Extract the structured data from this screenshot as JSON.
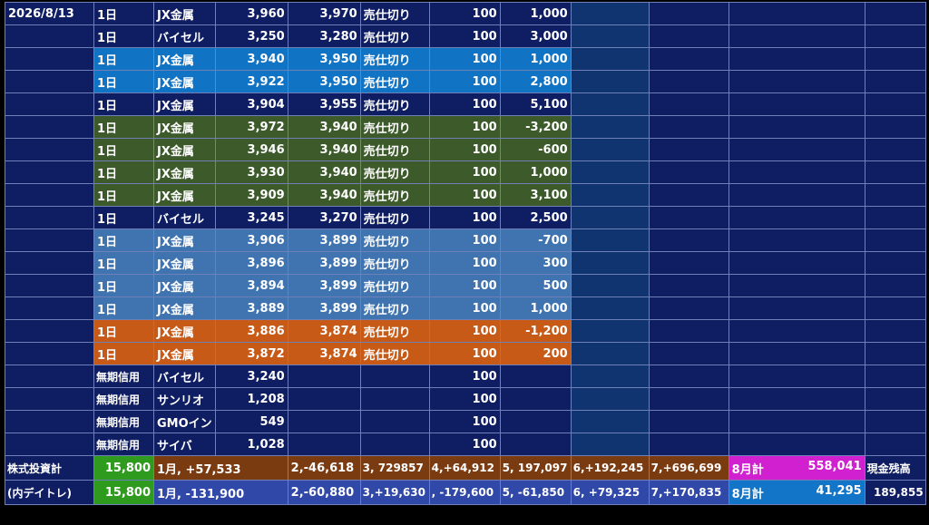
{
  "trades": [
    {
      "date": "2026/8/13",
      "period": "1日",
      "name": "JX金属",
      "buy": "3,960",
      "sell": "3,970",
      "type": "売仕切り",
      "qty": "100",
      "pnl": "1,000",
      "color": "dark"
    },
    {
      "date": "",
      "period": "1日",
      "name": "バイセル",
      "buy": "3,250",
      "sell": "3,280",
      "type": "売仕切り",
      "qty": "100",
      "pnl": "3,000",
      "color": "dark"
    },
    {
      "date": "",
      "period": "1日",
      "name": "JX金属",
      "buy": "3,940",
      "sell": "3,950",
      "type": "売仕切り",
      "qty": "100",
      "pnl": "1,000",
      "color": "blue"
    },
    {
      "date": "",
      "period": "1日",
      "name": "JX金属",
      "buy": "3,922",
      "sell": "3,950",
      "type": "売仕切り",
      "qty": "100",
      "pnl": "2,800",
      "color": "blue"
    },
    {
      "date": "",
      "period": "1日",
      "name": "JX金属",
      "buy": "3,904",
      "sell": "3,955",
      "type": "売仕切り",
      "qty": "100",
      "pnl": "5,100",
      "color": "dark"
    },
    {
      "date": "",
      "period": "1日",
      "name": "JX金属",
      "buy": "3,972",
      "sell": "3,940",
      "type": "売仕切り",
      "qty": "100",
      "pnl": "-3,200",
      "color": "green"
    },
    {
      "date": "",
      "period": "1日",
      "name": "JX金属",
      "buy": "3,946",
      "sell": "3,940",
      "type": "売仕切り",
      "qty": "100",
      "pnl": "-600",
      "color": "green"
    },
    {
      "date": "",
      "period": "1日",
      "name": "JX金属",
      "buy": "3,930",
      "sell": "3,940",
      "type": "売仕切り",
      "qty": "100",
      "pnl": "1,000",
      "color": "green"
    },
    {
      "date": "",
      "period": "1日",
      "name": "JX金属",
      "buy": "3,909",
      "sell": "3,940",
      "type": "売仕切り",
      "qty": "100",
      "pnl": "3,100",
      "color": "green"
    },
    {
      "date": "",
      "period": "1日",
      "name": "バイセル",
      "buy": "3,245",
      "sell": "3,270",
      "type": "売仕切り",
      "qty": "100",
      "pnl": "2,500",
      "color": "dark"
    },
    {
      "date": "",
      "period": "1日",
      "name": "JX金属",
      "buy": "3,906",
      "sell": "3,899",
      "type": "売仕切り",
      "qty": "100",
      "pnl": "-700",
      "color": "steel"
    },
    {
      "date": "",
      "period": "1日",
      "name": "JX金属",
      "buy": "3,896",
      "sell": "3,899",
      "type": "売仕切り",
      "qty": "100",
      "pnl": "300",
      "color": "steel"
    },
    {
      "date": "",
      "period": "1日",
      "name": "JX金属",
      "buy": "3,894",
      "sell": "3,899",
      "type": "売仕切り",
      "qty": "100",
      "pnl": "500",
      "color": "steel"
    },
    {
      "date": "",
      "period": "1日",
      "name": "JX金属",
      "buy": "3,889",
      "sell": "3,899",
      "type": "売仕切り",
      "qty": "100",
      "pnl": "1,000",
      "color": "steel"
    },
    {
      "date": "",
      "period": "1日",
      "name": "JX金属",
      "buy": "3,886",
      "sell": "3,874",
      "type": "売仕切り",
      "qty": "100",
      "pnl": "-1,200",
      "color": "orange"
    },
    {
      "date": "",
      "period": "1日",
      "name": "JX金属",
      "buy": "3,872",
      "sell": "3,874",
      "type": "売仕切り",
      "qty": "100",
      "pnl": "200",
      "color": "orange"
    }
  ],
  "holdings": [
    {
      "period": "無期信用",
      "name": "バイセル",
      "price": "3,240",
      "qty": "100"
    },
    {
      "period": "無期信用",
      "name": "サンリオ",
      "price": "1,208",
      "qty": "100"
    },
    {
      "period": "無期信用",
      "name": "GMOイン",
      "price": "549",
      "qty": "100"
    },
    {
      "period": "無期信用",
      "name": "サイバ",
      "price": "1,028",
      "qty": "100"
    }
  ],
  "summary": {
    "stock": {
      "label": "株式投資計",
      "value": "15,800",
      "m1": "1月, +57,533",
      "m2": "2,-46,618",
      "m3": "3, 729857",
      "m4": "4,+64,912",
      "m5": "5, 197,097",
      "m6": "6,+192,245",
      "m7": "7,+696,699",
      "month_label": "8月計",
      "month_value": "558,041",
      "cash_label": "現金残高"
    },
    "day": {
      "label": "(内デイトレ)",
      "value": "15,800",
      "m1": "1月, -131,900",
      "m2": "2,-60,880",
      "m3": "3,+19,630",
      "m4": ", -179,600",
      "m5": "5, -61,850",
      "m6": "6, +79,325",
      "m7": "7,+170,835",
      "month_label": "8月計",
      "month_value": "41,295",
      "cash_value": "189,855"
    }
  },
  "colors": {
    "dark": "#0f1d63",
    "blue": "#1173c4",
    "green": "#3c5a2a",
    "steel": "#3f74b0",
    "orange": "#c75a16",
    "grid": "#6f7fb8",
    "col8": "#0f3470",
    "summary_green": "#2f9b1e",
    "summary_brown": "#7b3b10",
    "summary_blue": "#3048a8",
    "summary_magenta": "#d020d0",
    "summary_blue2": "#1275c8"
  }
}
